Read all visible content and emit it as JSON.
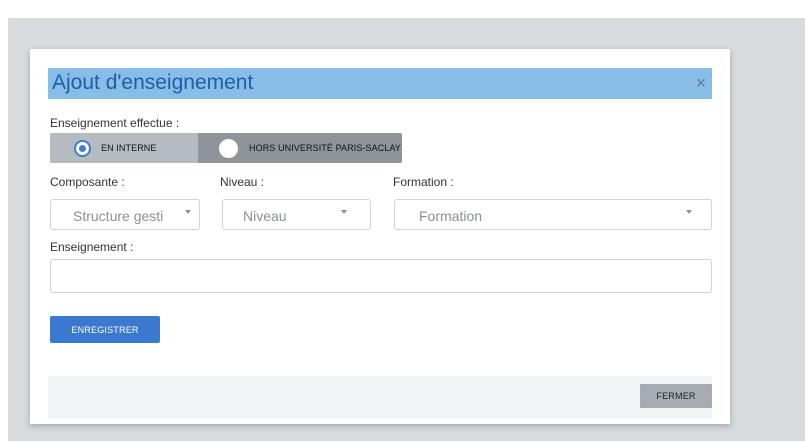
{
  "dialog": {
    "title": "Ajout d'enseignement",
    "close_symbol": "×"
  },
  "form": {
    "type_label": "Enseignement effectue :",
    "type_options": [
      {
        "label": "EN INTERNE",
        "selected": true
      },
      {
        "label": "HORS UNIVERSITÉ PARIS-SACLAY",
        "selected": false
      }
    ],
    "composante": {
      "label": "Composante :",
      "placeholder": "Structure gesti"
    },
    "niveau": {
      "label": "Niveau :",
      "placeholder": "Niveau"
    },
    "formation": {
      "label": "Formation :",
      "placeholder": "Formation"
    },
    "enseignement": {
      "label": "Enseignement :",
      "value": ""
    },
    "save_label": "ENREGISTRER"
  },
  "footer": {
    "close_label": "FERMER"
  },
  "colors": {
    "header_bg": "#87bde6",
    "title_text": "#1f5fa8",
    "primary_button": "#3b78d0",
    "radio_selected": "#3b7ed3"
  }
}
